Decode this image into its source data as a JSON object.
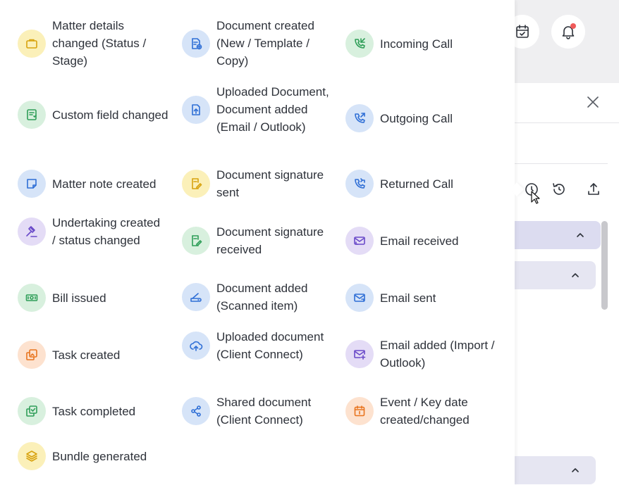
{
  "legend": {
    "items": [
      {
        "label": "Matter details changed (Status / Stage)",
        "icon": "briefcase-icon",
        "color": "yellow"
      },
      {
        "label": "Document created (New / Template / Copy)",
        "icon": "document-add-icon",
        "color": "blue"
      },
      {
        "label": "Incoming Call",
        "icon": "phone-incoming-icon",
        "color": "green"
      },
      {
        "label": "Custom field changed",
        "icon": "custom-field-icon",
        "color": "green"
      },
      {
        "label": "Uploaded Document, Document added (Email / Outlook)",
        "icon": "document-upload-icon",
        "color": "blue"
      },
      {
        "label": "Outgoing Call",
        "icon": "phone-outgoing-icon",
        "color": "blue"
      },
      {
        "label": "Matter note created",
        "icon": "note-icon",
        "color": "blue"
      },
      {
        "label": "Document signature sent",
        "icon": "signature-icon",
        "color": "yellow"
      },
      {
        "label": "Returned Call",
        "icon": "phone-returned-icon",
        "color": "blue"
      },
      {
        "label": "Undertaking created / status changed",
        "icon": "gavel-icon",
        "color": "purple"
      },
      {
        "label": "Document signature received",
        "icon": "signature-received-icon",
        "color": "green"
      },
      {
        "label": "Email received",
        "icon": "email-received-icon",
        "color": "purple"
      },
      {
        "label": "Bill issued",
        "icon": "bill-icon",
        "color": "green"
      },
      {
        "label": "Document added (Scanned item)",
        "icon": "scanner-icon",
        "color": "blue"
      },
      {
        "label": "Email sent",
        "icon": "email-sent-icon",
        "color": "blue"
      },
      {
        "label": "Task created",
        "icon": "task-icon",
        "color": "orange"
      },
      {
        "label": "Uploaded document (Client Connect)",
        "icon": "cloud-upload-icon",
        "color": "blue"
      },
      {
        "label": "Email added (Import / Outlook)",
        "icon": "email-add-icon",
        "color": "purple"
      },
      {
        "label": "Task completed",
        "icon": "task-complete-icon",
        "color": "green"
      },
      {
        "label": "Shared document (Client Connect)",
        "icon": "share-icon",
        "color": "blue"
      },
      {
        "label": "Event / Key date created/changed",
        "icon": "calendar-icon",
        "color": "orange"
      },
      {
        "label": "Bundle generated",
        "icon": "layers-icon",
        "color": "yellow"
      }
    ]
  },
  "colors": {
    "yellow": "#fbf0b9",
    "green": "#d8f0de",
    "blue": "#d6e4f8",
    "purple": "#e4dcf6",
    "orange": "#fde2cf",
    "notification_dot": "#ef5a5a",
    "accordion": "#dcdcf0"
  },
  "header_icons": [
    "calendar-check-icon",
    "bell-icon"
  ],
  "toolbar_icons": [
    "clock-icon",
    "history-icon",
    "export-icon"
  ]
}
